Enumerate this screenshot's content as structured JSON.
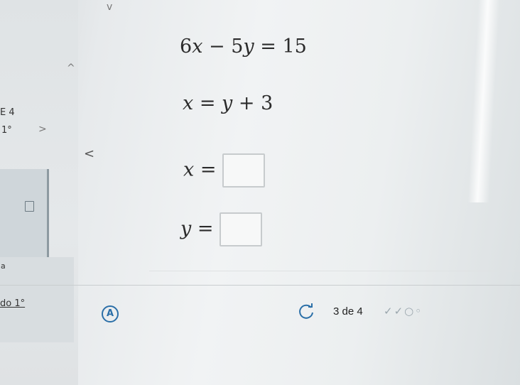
{
  "equations": {
    "eq1": {
      "a": "6",
      "v1": "x",
      "op": "−",
      "b": "5",
      "v2": "y",
      "eq": "=",
      "rhs": "15"
    },
    "eq2": {
      "lhs": "x",
      "eq": "=",
      "v": "y",
      "op": "+",
      "c": "3"
    },
    "ans_x": {
      "var": "x",
      "eq": "="
    },
    "ans_y": {
      "var": "y",
      "eq": "="
    }
  },
  "sidebar": {
    "label_e4": "E 4",
    "label_1deg": "1°",
    "label_dot": "a",
    "label_do": "do 1°",
    "chevron_up": "^",
    "chevron_right": ">",
    "chevron_left": "<",
    "chevron_down": "v"
  },
  "footer": {
    "progress": "3 de 4",
    "help_glyph": "A",
    "status_marks": "✓✓○◦"
  },
  "icons": {
    "help": "help-icon",
    "refresh": "refresh-icon",
    "document": "document-icon"
  },
  "colors": {
    "accent": "#2b6fa8",
    "muted": "#9aa6ad"
  }
}
